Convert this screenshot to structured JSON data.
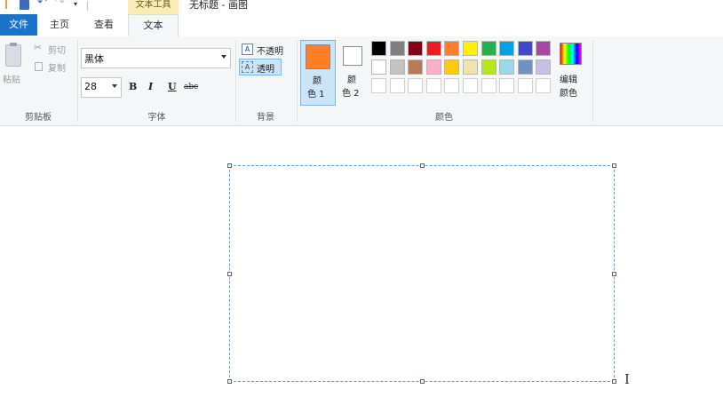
{
  "title_bar": {
    "context_tab_label": "文本工具",
    "document_title": "无标题 - 画图"
  },
  "tabs": {
    "file": "文件",
    "home": "主页",
    "view": "查看",
    "text": "文本"
  },
  "clipboard": {
    "paste_label": "粘贴",
    "cut_label": "剪切",
    "copy_label": "复制",
    "group_label": "剪贴板"
  },
  "font": {
    "family_value": "黑体",
    "size_value": "28",
    "bold_label": "B",
    "italic_label": "I",
    "underline_label": "U",
    "strike_label": "abc",
    "group_label": "字体"
  },
  "background": {
    "opaque_label": "不透明",
    "transparent_label": "透明",
    "group_label": "背景"
  },
  "colors": {
    "color1_line1": "颜",
    "color1_line2": "色 1",
    "color2_line1": "颜",
    "color2_line2": "色 2",
    "color1_value": "#ff7f27",
    "color2_value": "#ffffff",
    "palette_row1": [
      "#000000",
      "#7f7f7f",
      "#880015",
      "#ed1c24",
      "#ff7f27",
      "#fff200",
      "#22b14c",
      "#00a2e8",
      "#3f48cc",
      "#a349a4"
    ],
    "palette_row2": [
      "#ffffff",
      "#c3c3c3",
      "#b97a57",
      "#ffaec9",
      "#ffc90e",
      "#efe4b0",
      "#b5e61d",
      "#99d9ea",
      "#7092be",
      "#c8bfe7"
    ],
    "edit_label_line1": "编辑",
    "edit_label_line2": "颜色",
    "group_label": "颜色"
  }
}
